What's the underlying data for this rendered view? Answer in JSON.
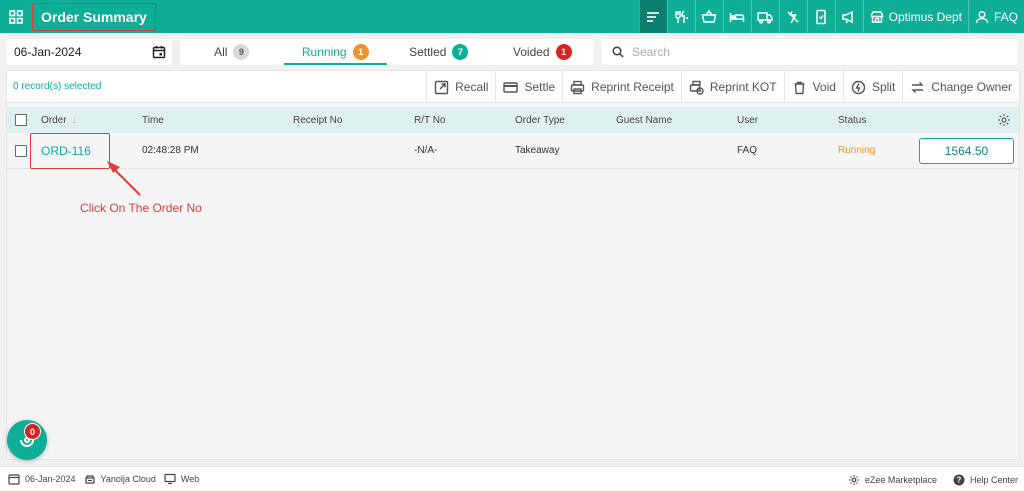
{
  "header": {
    "title": "Order Summary",
    "dept_label": "Optimus Dept",
    "faq_label": "FAQ",
    "icons": [
      "orders-icon",
      "kitchen-icon",
      "basket-icon",
      "bed-icon",
      "delivery-icon",
      "no-tax-icon",
      "mobile-icon",
      "megaphone-icon"
    ]
  },
  "filters": {
    "date": "06-Jan-2024",
    "tabs": [
      {
        "label": "All",
        "count": "9",
        "color": "#d9d9d9"
      },
      {
        "label": "Running",
        "count": "1",
        "color": "#f0932b"
      },
      {
        "label": "Settled",
        "count": "7",
        "color": "#0fae96"
      },
      {
        "label": "Voided",
        "count": "1",
        "color": "#d72525"
      }
    ],
    "search_placeholder": "Search"
  },
  "toolbar": {
    "records_selected": "0 record(s) selected",
    "recall": "Recall",
    "settle": "Settle",
    "reprint_receipt": "Reprint Receipt",
    "reprint_kot": "Reprint KOT",
    "void": "Void",
    "split": "Split",
    "change_owner": "Change Owner"
  },
  "table": {
    "columns": {
      "order": "Order",
      "time": "Time",
      "receipt_no": "Receipt No",
      "rt_no": "R/T No",
      "order_type": "Order Type",
      "guest_name": "Guest Name",
      "user": "User",
      "status": "Status"
    },
    "rows": [
      {
        "order": "ORD-116",
        "time": "02:48:28 PM",
        "receipt_no": "",
        "rt_no": "-N/A-",
        "order_type": "Takeaway",
        "guest_name": "",
        "user": "FAQ",
        "status": "Running",
        "amount": "1564.50"
      }
    ]
  },
  "annotation": {
    "text": "Click On The Order No"
  },
  "notifications": {
    "count": "0"
  },
  "footer": {
    "date": "06-Jan-2024",
    "cloud": "Yanolja Cloud",
    "platform": "Web",
    "marketplace": "eZee Marketplace",
    "help": "Help Center"
  },
  "colors": {
    "brand": "#0fae96",
    "highlight": "#e23b3b",
    "running": "#f0932b"
  }
}
